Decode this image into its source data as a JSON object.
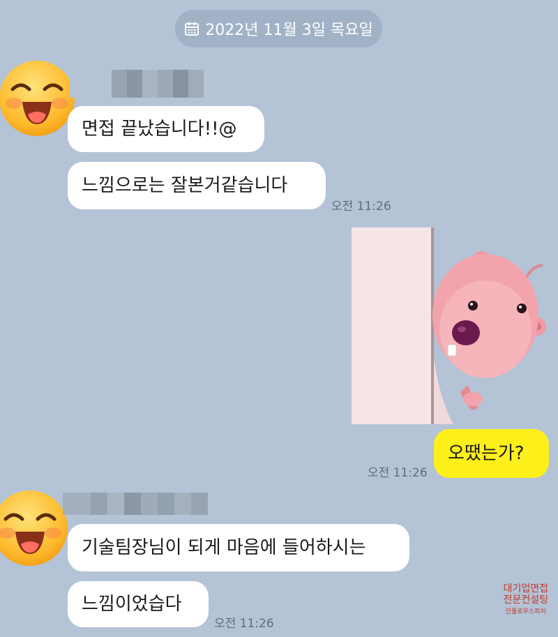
{
  "date_divider": {
    "icon": "calendar-icon",
    "text": "2022년 11월 3일 목요일"
  },
  "messages": [
    {
      "text": "면접 끝났습니다!!@"
    },
    {
      "text": "느낌으로는 잘본거같습니다",
      "time": "오전 11:26"
    },
    {
      "text": "오땠는가?",
      "time": "오전 11:26"
    },
    {
      "text": "기술팀장님이 되게 마음에 들어하시는"
    },
    {
      "text": "느낌이었습다",
      "time": "오전 11:26"
    }
  ],
  "watermark": {
    "line1": "대기업면접",
    "line2": "전문컨설팅",
    "line3": "인플로우스피치"
  },
  "colors": {
    "background": "#b4c3d6",
    "my_bubble": "#fef01b",
    "their_bubble": "#ffffff",
    "watermark": "#c0392b"
  }
}
